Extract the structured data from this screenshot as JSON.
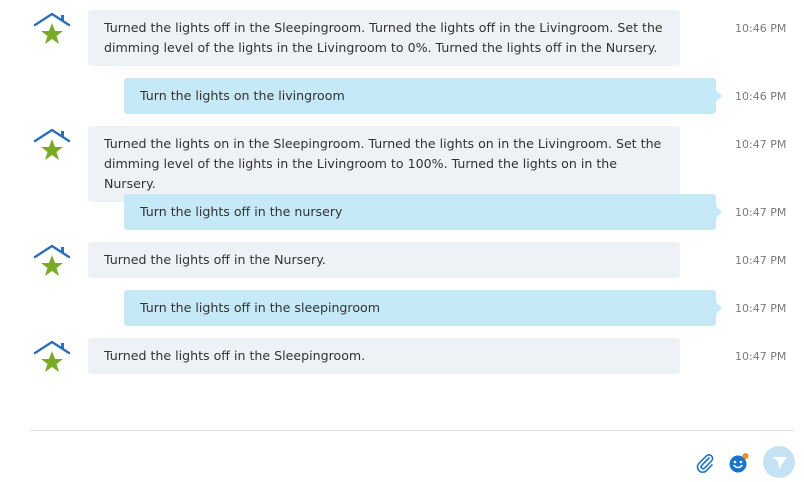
{
  "colors": {
    "bot_bubble": "#eef1f5",
    "user_bubble": "#c6e9f8",
    "house_blue": "#2a6fb8",
    "star_green": "#7aa927",
    "timestamp": "#7a7a7a",
    "send_button": "#c5e2f4"
  },
  "messages": [
    {
      "sender": "bot",
      "text": "Turned the lights off in the Sleepingroom. Turned the lights off in the Livingroom. Set the dimming level of the lights in the Livingroom to 0%. Turned the lights off in the Nursery.",
      "time": "10:46 PM"
    },
    {
      "sender": "user",
      "text": "Turn the lights on the livingroom",
      "time": "10:46 PM"
    },
    {
      "sender": "bot",
      "text": "Turned the lights on in the Sleepingroom. Turned the lights on in the Livingroom. Set the dimming level of the lights in the Livingroom to 100%. Turned the lights on in the Nursery.",
      "time": "10:47 PM"
    },
    {
      "sender": "user",
      "text": "Turn the lights off in the nursery",
      "time": "10:47 PM"
    },
    {
      "sender": "bot",
      "text": "Turned the lights off in the Nursery.",
      "time": "10:47 PM"
    },
    {
      "sender": "user",
      "text": "Turn the lights off in the sleepingroom",
      "time": "10:47 PM"
    },
    {
      "sender": "bot",
      "text": "Turned the lights off in the Sleepingroom.",
      "time": "10:47 PM"
    }
  ],
  "compose": {
    "attach_icon": "paperclip-icon",
    "emoji_icon": "emoji-icon",
    "send_icon": "send-icon"
  }
}
